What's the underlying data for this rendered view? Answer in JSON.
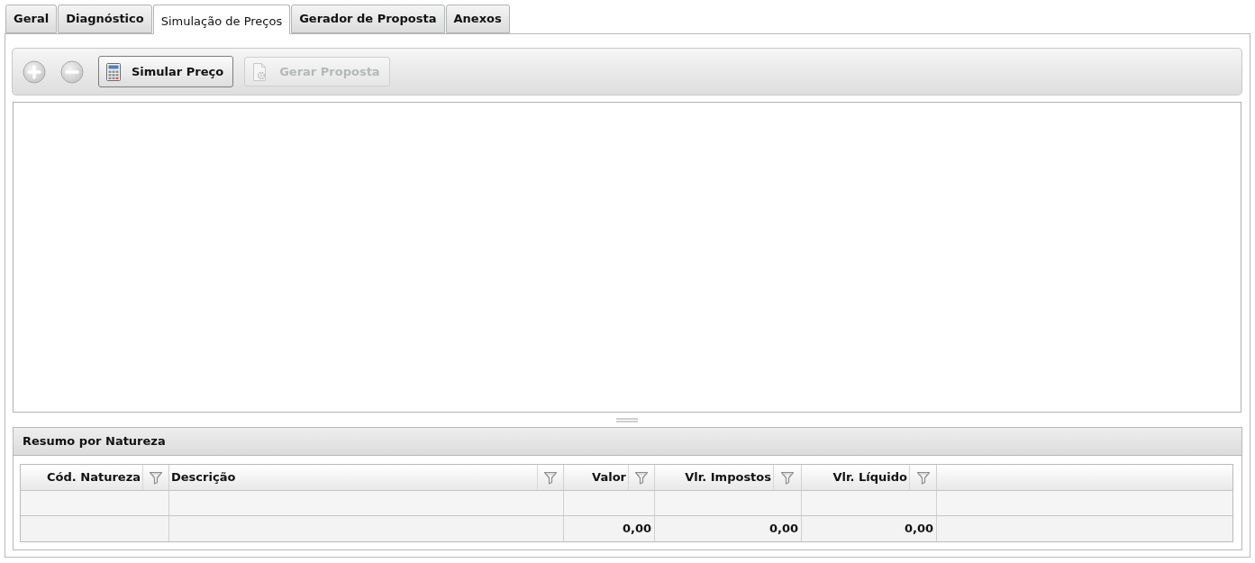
{
  "tabs": [
    {
      "label": "Geral",
      "selected": false
    },
    {
      "label": "Diagnóstico",
      "selected": false
    },
    {
      "label": "Simulação de Preços",
      "selected": true
    },
    {
      "label": "Gerador de Proposta",
      "selected": false
    },
    {
      "label": "Anexos",
      "selected": false
    }
  ],
  "toolbar": {
    "buttons": [
      {
        "kind": "add",
        "disabled": true
      },
      {
        "kind": "remove",
        "disabled": true
      },
      {
        "kind": "simulate",
        "label": "Simular Preço",
        "disabled": false
      },
      {
        "kind": "proposal",
        "label": "Gerar Proposta",
        "disabled": true
      }
    ]
  },
  "summary_panel": {
    "title": "Resumo por Natureza",
    "table": {
      "columns": [
        {
          "label": "Cód. Natureza",
          "kind": "code"
        },
        {
          "label": "Descrição",
          "kind": "text"
        },
        {
          "label": "Valor",
          "kind": "number",
          "total": "0,00"
        },
        {
          "label": "Vlr. Impostos",
          "kind": "number",
          "total": "0,00"
        },
        {
          "label": "Vlr. Líquido",
          "kind": "number",
          "total": "0,00"
        }
      ]
    }
  }
}
